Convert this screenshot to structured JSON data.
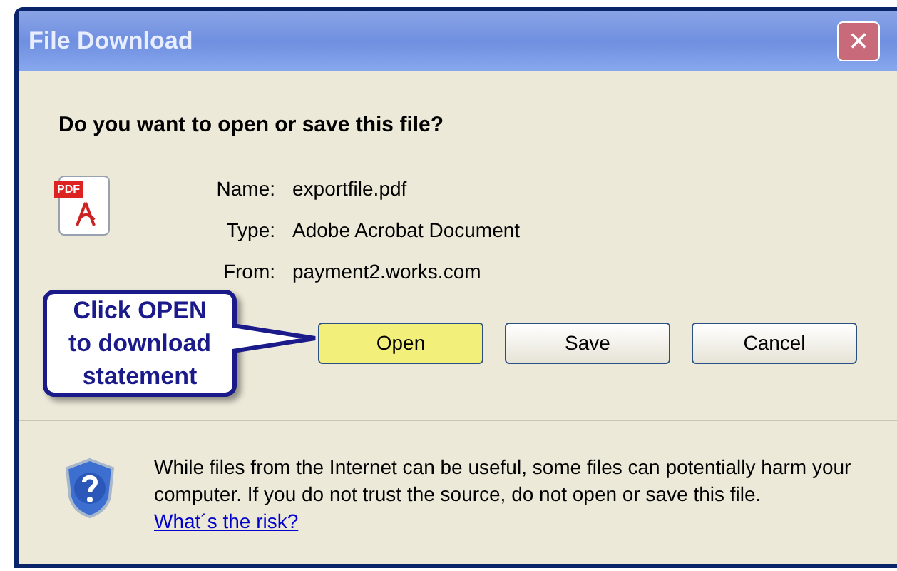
{
  "window": {
    "title": "File Download",
    "close": "✕"
  },
  "question": "Do you want to open or save this file?",
  "file_icon": {
    "badge": "PDF"
  },
  "details": [
    {
      "label": "Name:",
      "value": "exportfile.pdf"
    },
    {
      "label": "Type:",
      "value": "Adobe Acrobat Document"
    },
    {
      "label": "From:",
      "value": "payment2.works.com"
    }
  ],
  "buttons": [
    {
      "label": "Open",
      "highlighted": true
    },
    {
      "label": "Save",
      "highlighted": false
    },
    {
      "label": "Cancel",
      "highlighted": false
    }
  ],
  "callout": {
    "lines": [
      "Click OPEN",
      "to download",
      "statement"
    ]
  },
  "warning": {
    "text": "While files from the Internet can be useful, some files can potentially harm your computer. If you do not trust the source, do not open or save this file.",
    "link": "What´s the risk?"
  }
}
